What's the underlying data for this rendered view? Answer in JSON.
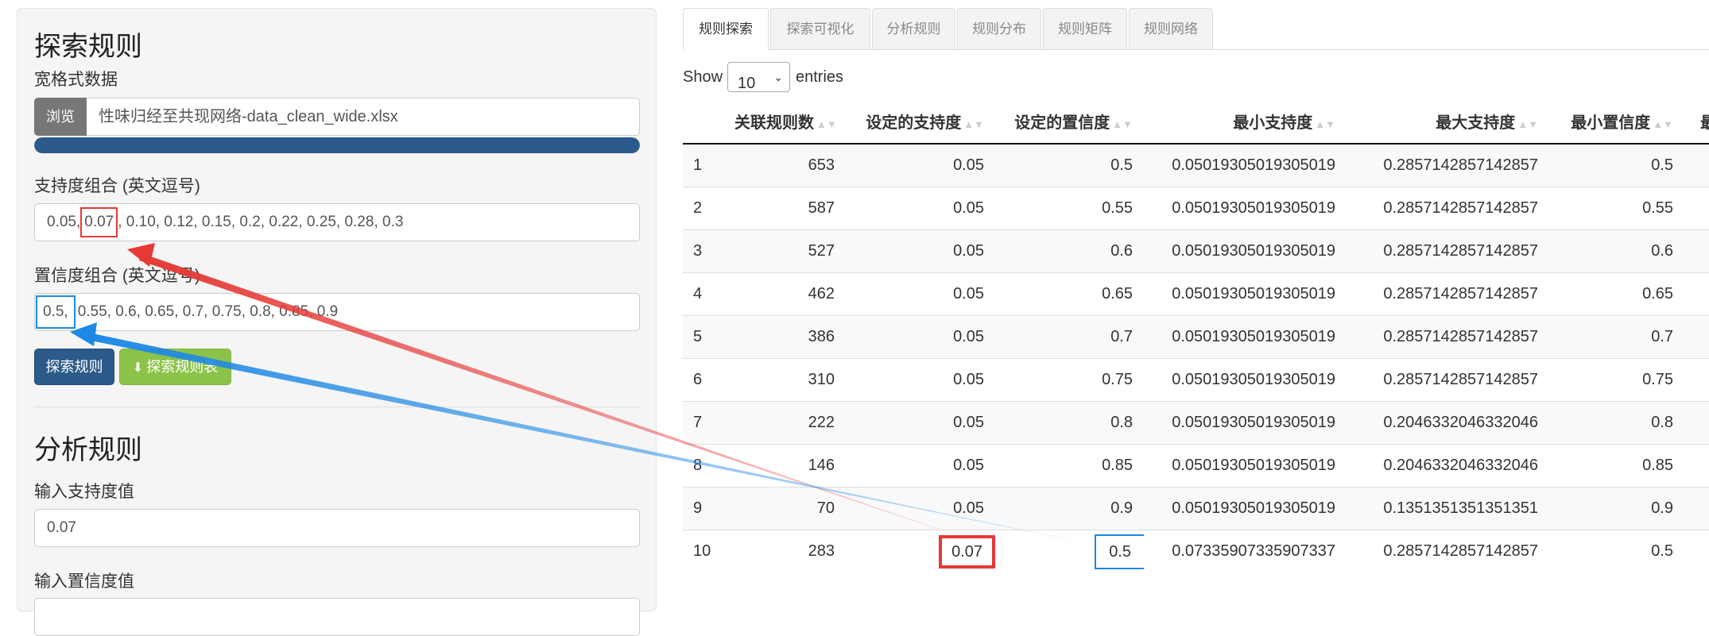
{
  "sidebar": {
    "explore_title": "探索规则",
    "wide_label": "宽格式数据",
    "browse_label": "浏览",
    "file_name": "性味归经至共现网络-data_clean_wide.xlsx",
    "upload_progress": 1.0,
    "support_label": "支持度组合 (英文逗号)",
    "support_prefix": "0.05,",
    "support_highlight": "0.07",
    "support_rest": ", 0.10, 0.12, 0.15, 0.2, 0.22, 0.25, 0.28, 0.3",
    "confidence_label": "置信度组合 (英文逗号)",
    "confidence_highlight": "0.5,",
    "confidence_rest": "0.55, 0.6, 0.65, 0.7, 0.75, 0.8, 0.85, 0.9",
    "explore_button": "探索规则",
    "download_button": "探索规则表",
    "analyze_title": "分析规则",
    "input_support_label": "输入支持度值",
    "input_support_value": "0.07",
    "input_confidence_label": "输入置信度值"
  },
  "tabs": [
    "规则探索",
    "探索可视化",
    "分析规则",
    "规则分布",
    "规则矩阵",
    "规则网络"
  ],
  "table_controls": {
    "show": "Show",
    "entries_value": "10",
    "entries": "entries"
  },
  "table": {
    "headers": [
      "",
      "关联规则数",
      "设定的支持度",
      "设定的置信度",
      "最小支持度",
      "最大支持度",
      "最小置信度",
      "最"
    ],
    "rows": [
      [
        "1",
        "653",
        "0.05",
        "0.5",
        "0.05019305019305019",
        "0.2857142857142857",
        "0.5"
      ],
      [
        "2",
        "587",
        "0.05",
        "0.55",
        "0.05019305019305019",
        "0.2857142857142857",
        "0.55"
      ],
      [
        "3",
        "527",
        "0.05",
        "0.6",
        "0.05019305019305019",
        "0.2857142857142857",
        "0.6"
      ],
      [
        "4",
        "462",
        "0.05",
        "0.65",
        "0.05019305019305019",
        "0.2857142857142857",
        "0.65"
      ],
      [
        "5",
        "386",
        "0.05",
        "0.7",
        "0.05019305019305019",
        "0.2857142857142857",
        "0.7"
      ],
      [
        "6",
        "310",
        "0.05",
        "0.75",
        "0.05019305019305019",
        "0.2857142857142857",
        "0.75"
      ],
      [
        "7",
        "222",
        "0.05",
        "0.8",
        "0.05019305019305019",
        "0.2046332046332046",
        "0.8"
      ],
      [
        "8",
        "146",
        "0.05",
        "0.85",
        "0.05019305019305019",
        "0.2046332046332046",
        "0.85"
      ],
      [
        "9",
        "70",
        "0.05",
        "0.9",
        "0.05019305019305019",
        "0.1351351351351351",
        "0.9"
      ],
      [
        "10",
        "283",
        "0.07",
        "0.5",
        "0.07335907335907337",
        "0.2857142857142857",
        "0.5"
      ]
    ]
  },
  "colors": {
    "primary": "#2c5a8a",
    "success": "#8bc34a",
    "annotation_red": "#e53935",
    "annotation_blue": "#1e88e5"
  }
}
